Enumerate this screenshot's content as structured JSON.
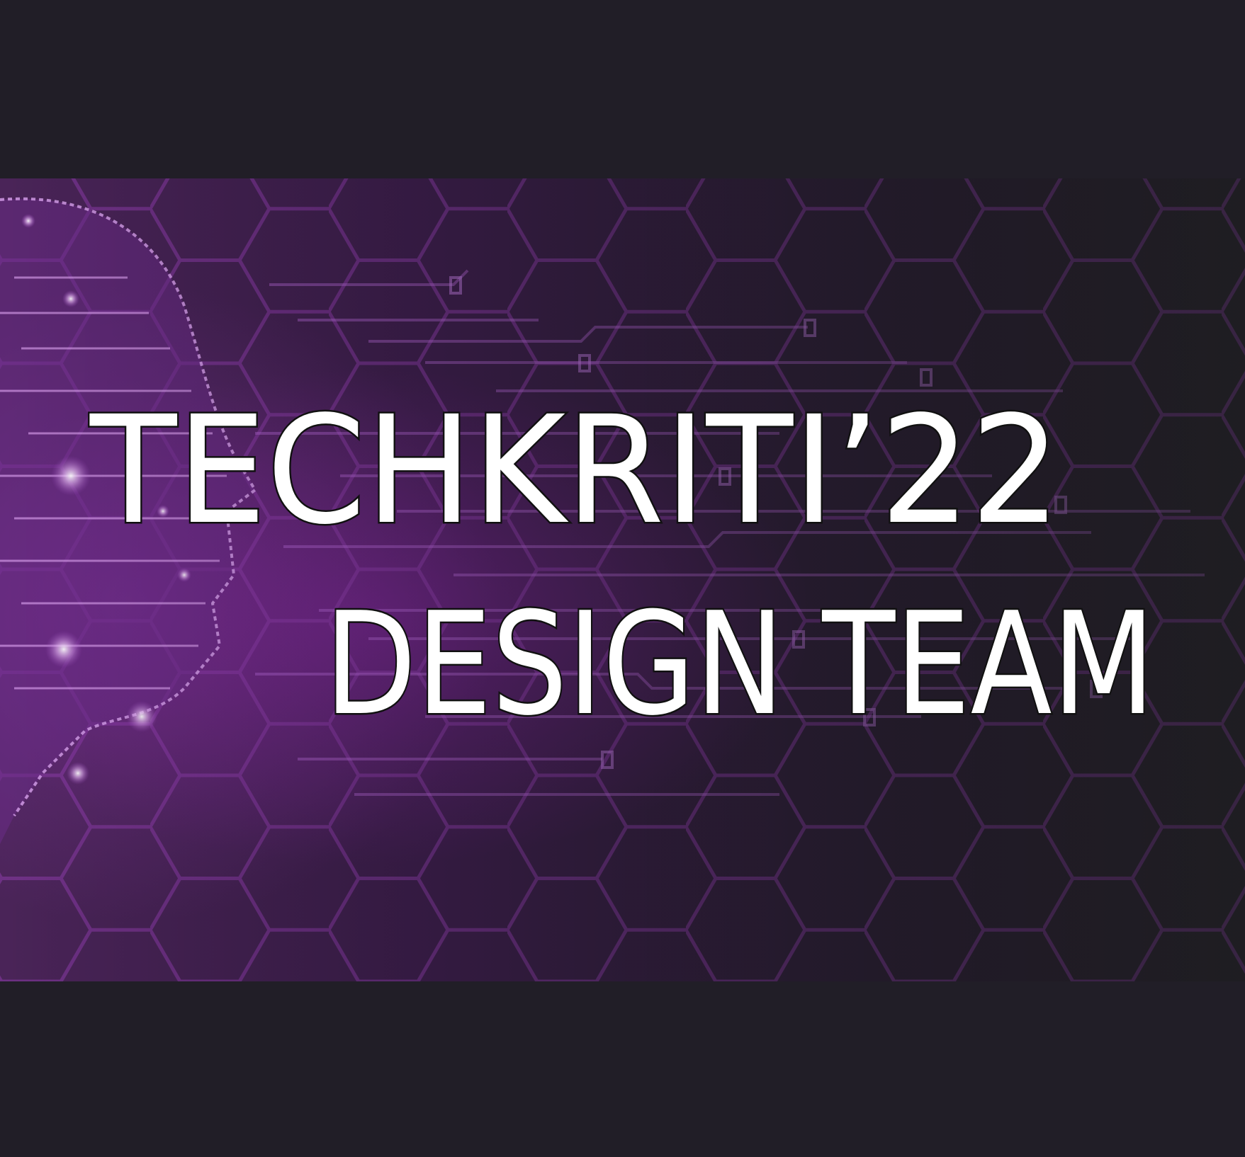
{
  "banner": {
    "title_line1": "TECHKRITI’22",
    "title_line2": "DESIGN TEAM"
  },
  "colors": {
    "background_bars": "#211e27",
    "accent_purple": "#a14fc4",
    "text_fill": "#ffffff",
    "text_outline": "#111111"
  }
}
